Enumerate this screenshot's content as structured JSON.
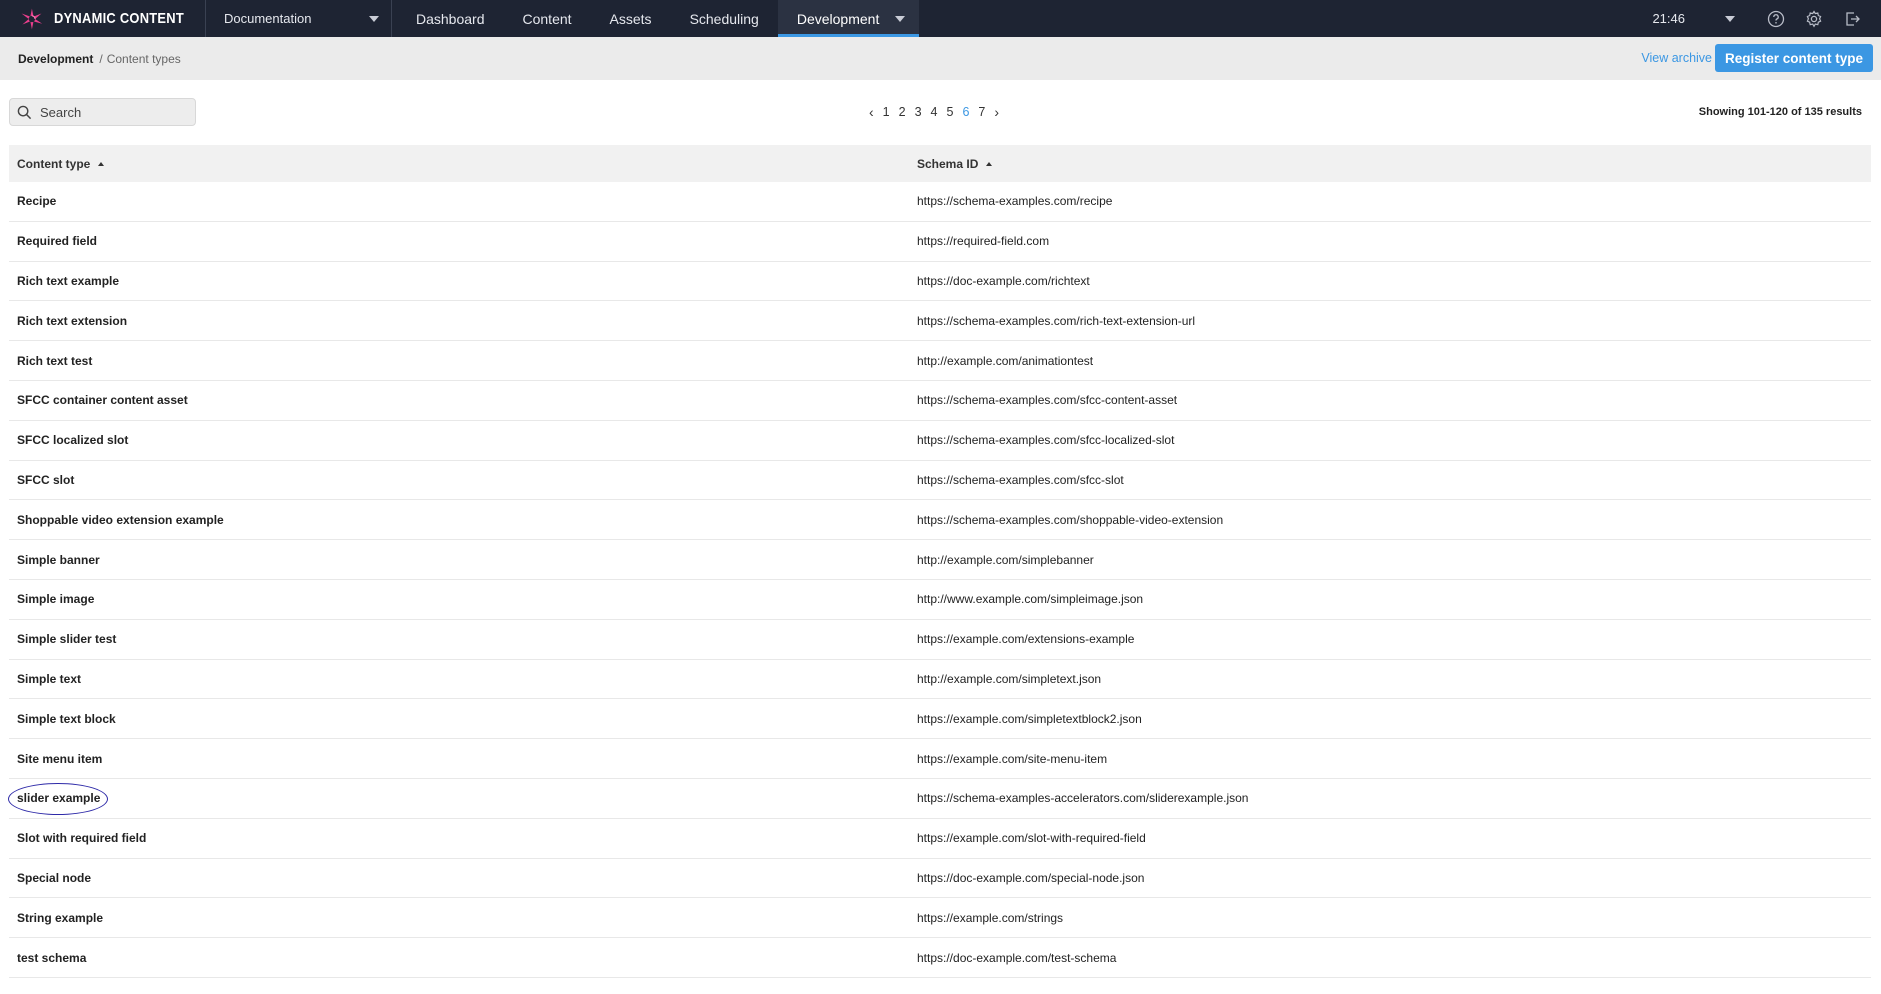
{
  "app": {
    "logo_text": "DYNAMIC CONTENT",
    "hub": "Documentation",
    "tabs": [
      "Dashboard",
      "Content",
      "Assets",
      "Scheduling",
      "Development"
    ],
    "active_tab": "Development",
    "clock": "21:46",
    "accent_color": "#3b97e3",
    "nav_bg_color": "#1e2433",
    "icons": [
      "help-icon",
      "settings-icon",
      "logout-icon"
    ]
  },
  "breadcrumb": {
    "root": "Development",
    "separator": "/",
    "leaf": "Content types"
  },
  "actions": {
    "view_archive": "View archive",
    "register": "Register content type"
  },
  "search": {
    "placeholder": "Search",
    "value": ""
  },
  "pagination": {
    "pages": [
      "1",
      "2",
      "3",
      "4",
      "5",
      "6",
      "7"
    ],
    "current": "6"
  },
  "results_text": "Showing 101-120 of 135 results",
  "table": {
    "columns": [
      "Content type",
      "Schema ID"
    ],
    "rows": [
      {
        "name": "Recipe",
        "schema": "https://schema-examples.com/recipe"
      },
      {
        "name": "Required field",
        "schema": "https://required-field.com"
      },
      {
        "name": "Rich text example",
        "schema": "https://doc-example.com/richtext"
      },
      {
        "name": "Rich text extension",
        "schema": "https://schema-examples.com/rich-text-extension-url"
      },
      {
        "name": "Rich text test",
        "schema": "http://example.com/animationtest"
      },
      {
        "name": "SFCC container content asset",
        "schema": "https://schema-examples.com/sfcc-content-asset"
      },
      {
        "name": "SFCC localized slot",
        "schema": "https://schema-examples.com/sfcc-localized-slot"
      },
      {
        "name": "SFCC slot",
        "schema": "https://schema-examples.com/sfcc-slot"
      },
      {
        "name": "Shoppable video extension example",
        "schema": "https://schema-examples.com/shoppable-video-extension"
      },
      {
        "name": "Simple banner",
        "schema": "http://example.com/simplebanner"
      },
      {
        "name": "Simple image",
        "schema": "http://www.example.com/simpleimage.json"
      },
      {
        "name": "Simple slider test",
        "schema": "https://example.com/extensions-example"
      },
      {
        "name": "Simple text",
        "schema": "http://example.com/simpletext.json"
      },
      {
        "name": "Simple text block",
        "schema": "https://example.com/simpletextblock2.json"
      },
      {
        "name": "Site menu item",
        "schema": "https://example.com/site-menu-item"
      },
      {
        "name": "slider example",
        "schema": "https://schema-examples-accelerators.com/sliderexample.json",
        "highlighted": true
      },
      {
        "name": "Slot with required field",
        "schema": "https://example.com/slot-with-required-field"
      },
      {
        "name": "Special node",
        "schema": "https://doc-example.com/special-node.json"
      },
      {
        "name": "String example",
        "schema": "https://example.com/strings"
      },
      {
        "name": "test schema",
        "schema": "https://doc-example.com/test-schema"
      }
    ]
  }
}
